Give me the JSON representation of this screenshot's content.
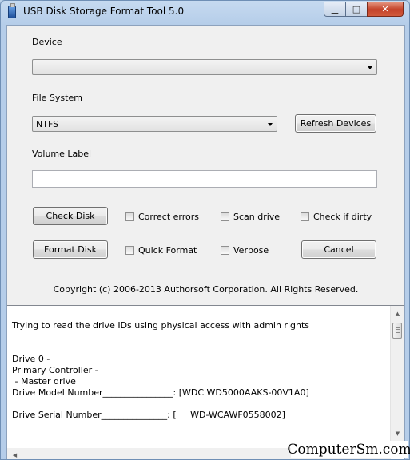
{
  "window": {
    "title": "USB Disk Storage Format Tool 5.0",
    "min_label": "▁",
    "max_label": "□",
    "close_label": "✕"
  },
  "device": {
    "label": "Device",
    "value": ""
  },
  "file_system": {
    "label": "File System",
    "value": "NTFS"
  },
  "buttons": {
    "refresh": "Refresh Devices",
    "check_disk": "Check Disk",
    "format_disk": "Format Disk",
    "cancel": "Cancel"
  },
  "volume_label": {
    "label": "Volume Label",
    "value": ""
  },
  "checkboxes": {
    "correct_errors": "Correct errors",
    "scan_drive": "Scan drive",
    "check_if_dirty": "Check if dirty",
    "quick_format": "Quick Format",
    "verbose": "Verbose"
  },
  "copyright": "Copyright (c) 2006-2013 Authorsoft Corporation. All Rights Reserved.",
  "log": {
    "lines": [
      "Trying to read the drive IDs using physical access with admin rights",
      "",
      "",
      "Drive 0 -",
      "Primary Controller -",
      " - Master drive",
      "Drive Model Number________________: [WDC WD5000AAKS-00V1A0]",
      "",
      "Drive Serial Number_______________: [     WD-WCAWF0558002]"
    ]
  },
  "watermark": "ComputerSm.com",
  "colors": {
    "title_bg": "#c6daf0",
    "client_bg": "#f0f0f0",
    "close_btn": "#c4432a"
  }
}
